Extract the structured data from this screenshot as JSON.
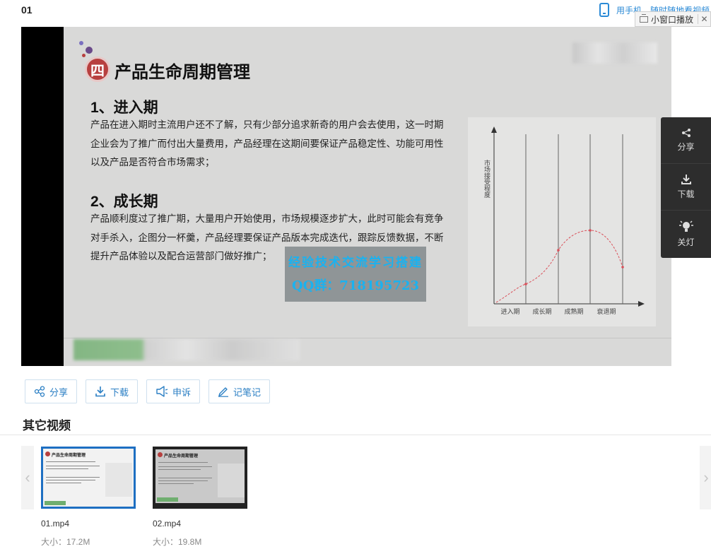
{
  "page": {
    "title": "01"
  },
  "header": {
    "mobile_hint": "用手机，随时随地看视频",
    "mini_player_label": "小窗口播放",
    "close_glyph": "✕"
  },
  "slide": {
    "badge": "四",
    "title": "产品生命周期管理",
    "section1_heading": "1、进入期",
    "section1_lines": [
      "产品在进入期时主流用户还不了解，只有少部分追求新奇的用户会去使用，这一时期",
      "企业会为了推广而付出大量费用，产品经理在这期间要保证产品稳定性、功能可用性",
      "以及产品是否符合市场需求；"
    ],
    "section2_heading": "2、成长期",
    "section2_lines": [
      "产品顺利度过了推广期，大量用户开始使用，市场规模逐步扩大，此时可能会有竞争",
      "对手杀入，企图分一杯羹，产品经理要保证产品版本完成迭代，跟踪反馈数据，不断",
      "提升产品体验以及配合运营部门做好推广；"
    ],
    "watermark_line1": "经验技术交流学习搭建",
    "watermark_line2": "QQ群：718195723",
    "chart_ylabel": "市场接受程度",
    "chart_stages": [
      "进入期",
      "成长期",
      "成熟期",
      "衰退期"
    ],
    "colors": {
      "badge": "#b7403f",
      "curve": "#d9505a",
      "watermark_text": "#1ab2f0"
    }
  },
  "side_panel": {
    "items": [
      {
        "label": "分享",
        "icon": "share-icon"
      },
      {
        "label": "下载",
        "icon": "download-icon"
      },
      {
        "label": "关灯",
        "icon": "lightbulb-icon"
      }
    ]
  },
  "actions": [
    {
      "label": "分享",
      "icon": "share-icon"
    },
    {
      "label": "下载",
      "icon": "download-icon"
    },
    {
      "label": "申诉",
      "icon": "megaphone-icon"
    },
    {
      "label": "记笔记",
      "icon": "pencil-icon"
    }
  ],
  "other_videos": {
    "heading": "其它视频",
    "items": [
      {
        "name": "01.mp4",
        "size": "大小：17.2M",
        "active": true
      },
      {
        "name": "02.mp4",
        "size": "大小：19.8M",
        "active": false
      }
    ],
    "prev_glyph": "‹",
    "next_glyph": "›"
  },
  "accent_color": "#2b7fc4"
}
